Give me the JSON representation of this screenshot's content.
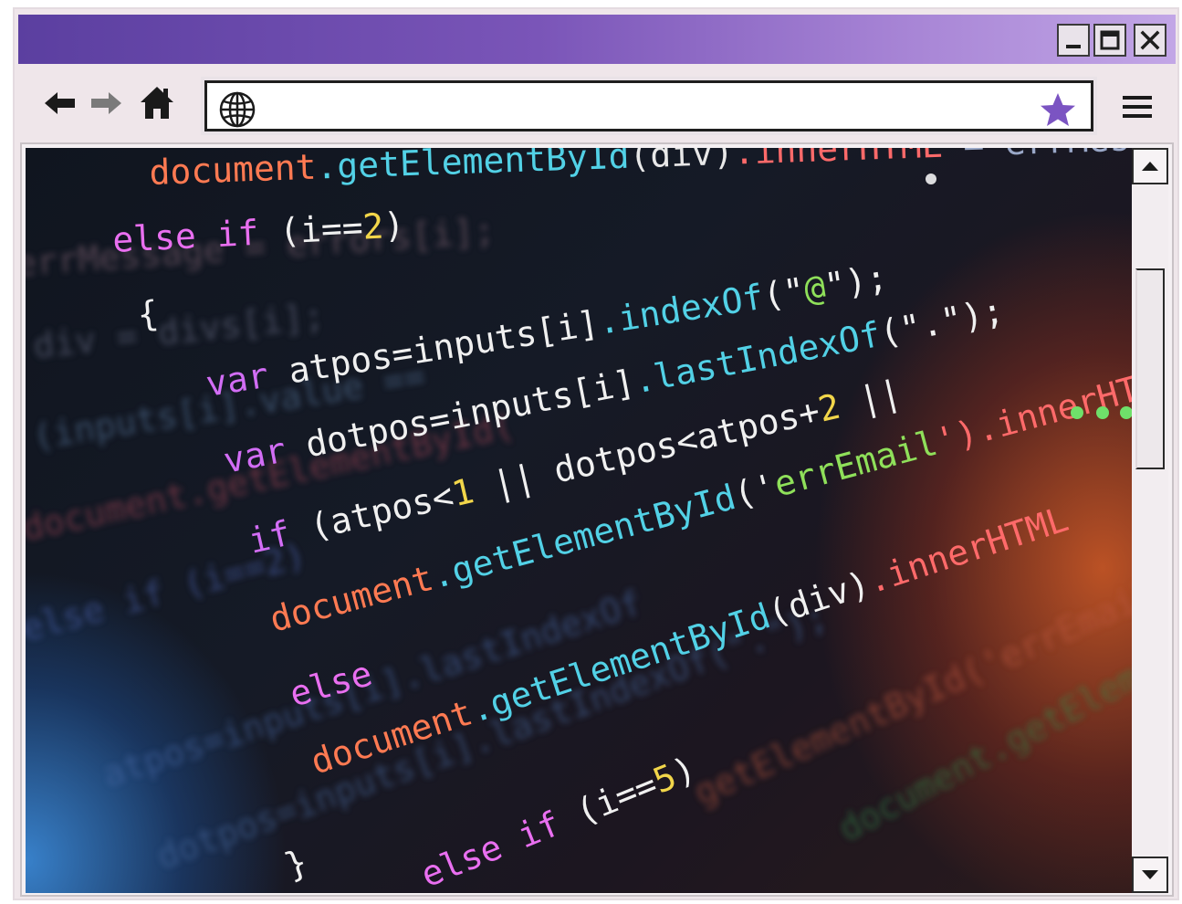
{
  "window": {
    "title_gradient": [
      "#5b3fa0",
      "#c2a6e6"
    ],
    "controls": [
      "minimize-icon",
      "maximize-icon",
      "close-icon"
    ]
  },
  "toolbar": {
    "icons": [
      "arrow-left-icon",
      "arrow-right-icon",
      "home-icon",
      "globe-icon",
      "star-icon",
      "hamburger-menu-icon"
    ],
    "star_color": "#7b54c2",
    "address": {
      "url": "",
      "placeholder": ""
    }
  },
  "code": {
    "lines": [
      [
        {
          "t": "document",
          "c": "#ff7a52"
        },
        {
          "t": ".getElementById",
          "c": "#52d1e6"
        },
        {
          "t": "(div)",
          "c": "#e8e8e8"
        },
        {
          "t": ".innerHTML",
          "c": "#ff6a6a"
        },
        {
          "t": " = errMessage",
          "c": "#9aa8c8"
        }
      ],
      [
        {
          "t": "else if",
          "c": "#e96ff0"
        },
        {
          "t": " (i==",
          "c": "#f0f0f0"
        },
        {
          "t": "2",
          "c": "#f2d64a"
        },
        {
          "t": ")",
          "c": "#f0f0f0"
        }
      ],
      [
        {
          "t": "{",
          "c": "#f0f0f0"
        }
      ],
      [
        {
          "t": "var",
          "c": "#d26df5"
        },
        {
          "t": " atpos=inputs[i]",
          "c": "#f0f0f0"
        },
        {
          "t": ".indexOf",
          "c": "#52d1e6"
        },
        {
          "t": "(\"",
          "c": "#f0f0f0"
        },
        {
          "t": "@",
          "c": "#8fe05a"
        },
        {
          "t": "\");",
          "c": "#f0f0f0"
        }
      ],
      [
        {
          "t": "var",
          "c": "#d26df5"
        },
        {
          "t": " dotpos=inputs[i]",
          "c": "#f0f0f0"
        },
        {
          "t": ".lastIndexOf",
          "c": "#52d1e6"
        },
        {
          "t": "(\".\");",
          "c": "#f0f0f0"
        }
      ],
      [
        {
          "t": "if",
          "c": "#d26df5"
        },
        {
          "t": " (atpos<",
          "c": "#f0f0f0"
        },
        {
          "t": "1",
          "c": "#f2d64a"
        },
        {
          "t": " || dotpos<atpos+",
          "c": "#f0f0f0"
        },
        {
          "t": "2",
          "c": "#f2d64a"
        },
        {
          "t": " ||",
          "c": "#f0f0f0"
        }
      ],
      [
        {
          "t": "document",
          "c": "#ff7a52"
        },
        {
          "t": ".getElementById",
          "c": "#52d1e6"
        },
        {
          "t": "('",
          "c": "#f0f0f0"
        },
        {
          "t": "errEmail",
          "c": "#8fe05a"
        },
        {
          "t": "').innerHTML",
          "c": "#ff6a6a"
        }
      ],
      [
        {
          "t": "else",
          "c": "#e96ff0"
        }
      ],
      [
        {
          "t": "document",
          "c": "#ff7a52"
        },
        {
          "t": ".getElementById",
          "c": "#52d1e6"
        },
        {
          "t": "(div)",
          "c": "#f0f0f0"
        },
        {
          "t": ".innerHTML",
          "c": "#ff6a6a"
        }
      ],
      [
        {
          "t": "}",
          "c": "#f0f0f0"
        }
      ],
      [
        {
          "t": "else if",
          "c": "#e96ff0"
        },
        {
          "t": " (i==",
          "c": "#f0f0f0"
        },
        {
          "t": "5",
          "c": "#f2d64a"
        },
        {
          "t": ")",
          "c": "#f0f0f0"
        }
      ]
    ],
    "background_lines": [
      "errMessage = errors[i];",
      "div = divs[i];",
      "(inputs[i].value ==",
      "document.getElementById(",
      "else if (i==2)",
      "atpos=inputs[i].lastIndexOf",
      "dotpos=inputs[i].lastIndexOf(\".\");",
      "getElementById('errEmail').innerHTML",
      "document.getElementById('confirm')"
    ]
  }
}
